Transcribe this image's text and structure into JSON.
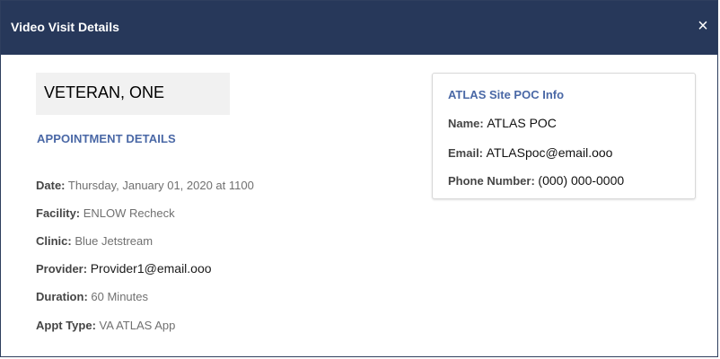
{
  "dialog": {
    "title": "Video Visit Details",
    "close_label": "×"
  },
  "patient": {
    "name": "VETERAN, ONE"
  },
  "appointment": {
    "section_title": "APPOINTMENT DETAILS",
    "rows": [
      {
        "label": "Date:",
        "value": "Thursday, January 01, 2020 at 1100"
      },
      {
        "label": "Facility:",
        "value": "ENLOW Recheck"
      },
      {
        "label": "Clinic:",
        "value": "Blue Jetstream"
      },
      {
        "label": "Provider:",
        "value": "Provider1@email.ooo"
      },
      {
        "label": "Duration:",
        "value": "60 Minutes"
      },
      {
        "label": "Appt Type:",
        "value": "VA ATLAS App"
      }
    ]
  },
  "poc": {
    "title": "ATLAS Site POC Info",
    "rows": [
      {
        "label": "Name:",
        "value": "ATLAS POC"
      },
      {
        "label": "Email:",
        "value": "ATLASpoc@email.ooo"
      },
      {
        "label": "Phone Number:",
        "value": "(000) 000-0000"
      }
    ]
  },
  "colors": {
    "header_bg": "#27385a",
    "section_title": "#4a68a6",
    "patient_box_bg": "#f1f1f1"
  },
  "icons": {
    "close": "close-icon"
  }
}
